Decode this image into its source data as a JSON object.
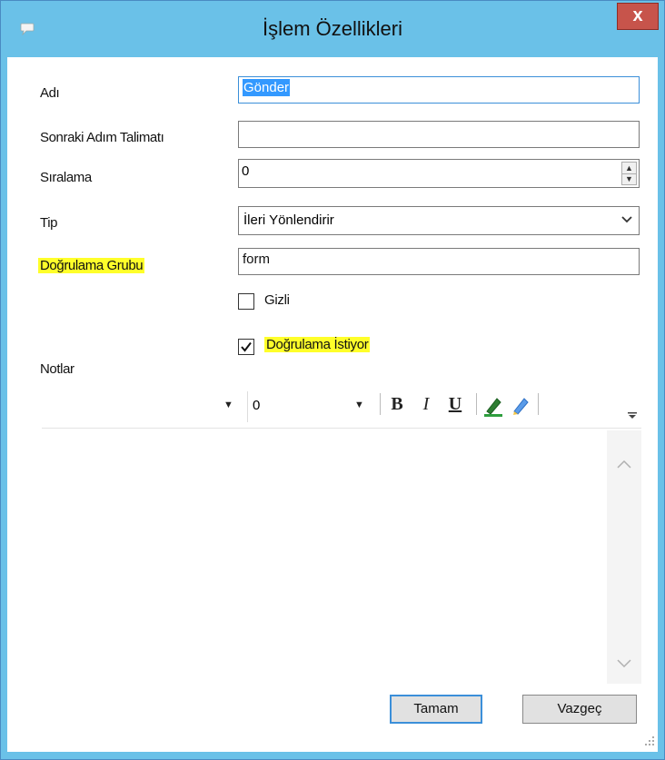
{
  "window": {
    "title": "İşlem Özellikleri",
    "close_label": "x"
  },
  "fields": {
    "name_label": "Adı",
    "name_value": "Gönder",
    "next_step_label": "Sonraki Adım Talimatı",
    "next_step_value": "",
    "order_label": "Sıralama",
    "order_value": "0",
    "type_label": "Tip",
    "type_value": "İleri Yönlendirir",
    "validation_group_label": "Doğrulama Grubu",
    "validation_group_value": "form"
  },
  "checkboxes": {
    "hidden_label": "Gizli",
    "hidden_checked": false,
    "requires_validation_label": "Doğrulama İstiyor",
    "requires_validation_checked": true
  },
  "notes": {
    "label": "Notlar",
    "font_value": "",
    "size_value": "0",
    "bold_label": "B",
    "italic_label": "I",
    "underline_label": "U",
    "content": ""
  },
  "buttons": {
    "ok_label": "Tamam",
    "cancel_label": "Vazgeç"
  },
  "colors": {
    "titlebar": "#6ac1e8",
    "highlight": "#ffff2a",
    "selection": "#3399ff",
    "close_button": "#c7544b"
  }
}
